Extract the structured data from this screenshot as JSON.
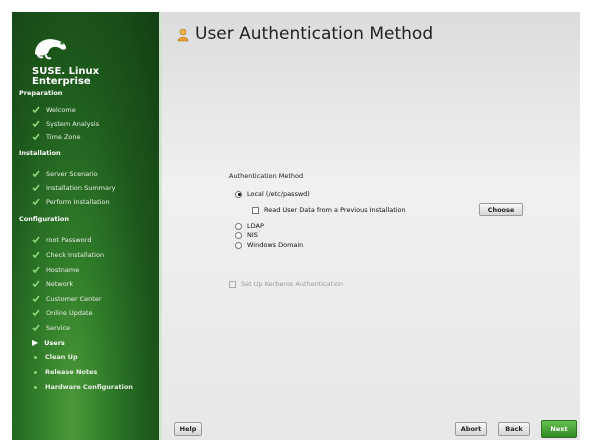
{
  "sidebar": {
    "brand_line1": "SUSE. Linux",
    "brand_line2": "Enterprise",
    "sections": [
      {
        "title": "Preparation"
      },
      {
        "title": "Installation"
      },
      {
        "title": "Configuration"
      }
    ],
    "preparation_items": [
      "Welcome",
      "System Analysis",
      "Time Zone"
    ],
    "installation_items": [
      "Server Scenario",
      "Installation Summary",
      "Perform Installation"
    ],
    "configuration_items_done": [
      "root Password",
      "Check Installation",
      "Hostname",
      "Network",
      "Customer Center",
      "Online Update",
      "Service"
    ],
    "current_item": "Users",
    "future_items": [
      "Clean Up",
      "Release Notes",
      "Hardware Configuration"
    ]
  },
  "main": {
    "title": "User Authentication Method",
    "group_label": "Authentication Method",
    "options": [
      {
        "label": "Local (/etc/passwd)",
        "selected": true
      },
      {
        "label": "LDAP",
        "selected": false
      },
      {
        "label": "NIS",
        "selected": false
      },
      {
        "label": "Windows Domain",
        "selected": false
      }
    ],
    "read_user_data_label": "Read User Data from a Previous Installation",
    "choose_label": "Choose",
    "kerberos_label": "Set Up Kerberos Authentication"
  },
  "buttons": {
    "help": "Help",
    "abort": "Abort",
    "back": "Back",
    "next": "Next"
  },
  "colors": {
    "sidebar_green": "#2f7a28",
    "next_button": "#3fa02f"
  }
}
